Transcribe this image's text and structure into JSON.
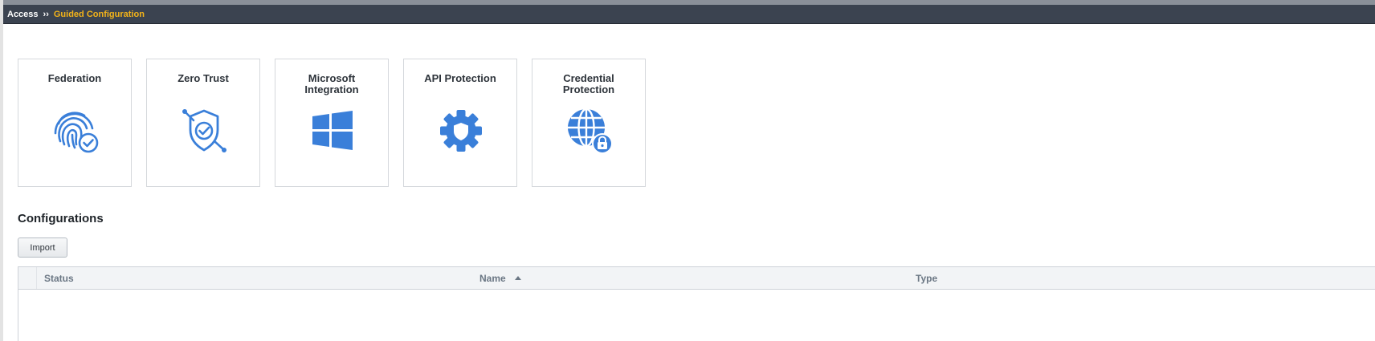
{
  "breadcrumb": {
    "root": "Access",
    "separator": "››",
    "current": "Guided Configuration"
  },
  "tiles": [
    {
      "title": "Federation",
      "icon": "fingerprint-check-icon"
    },
    {
      "title": "Zero Trust",
      "icon": "shield-check-icon"
    },
    {
      "title": "Microsoft Integration",
      "icon": "windows-logo-icon"
    },
    {
      "title": "API Protection",
      "icon": "gear-shield-icon"
    },
    {
      "title": "Credential Protection",
      "icon": "globe-lock-icon"
    }
  ],
  "configurations": {
    "title": "Configurations",
    "import_label": "Import",
    "columns": [
      "Status",
      "Name",
      "Type"
    ],
    "sort": {
      "column": "Name",
      "direction": "ascending"
    },
    "rows": []
  },
  "colors": {
    "accent": "#3a7fd9",
    "breadcrumb_bg": "#3b4350",
    "breadcrumb_current": "#f3b319"
  }
}
